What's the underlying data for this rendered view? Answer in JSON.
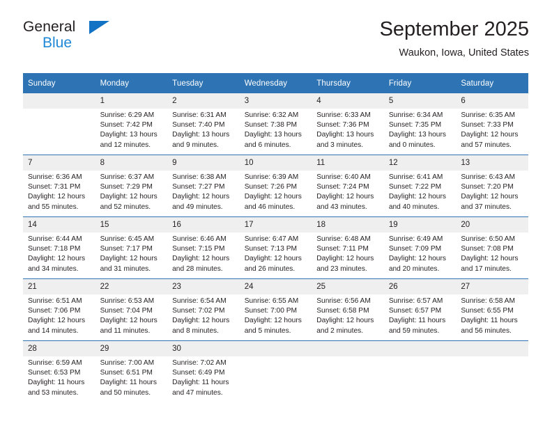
{
  "brand": {
    "name_top": "General",
    "name_bottom": "Blue",
    "triangle_color": "#1273c4",
    "accent_color": "#2e74b5"
  },
  "header": {
    "title": "September 2025",
    "subtitle": "Waukon, Iowa, United States"
  },
  "weekday_headers": [
    "Sunday",
    "Monday",
    "Tuesday",
    "Wednesday",
    "Thursday",
    "Friday",
    "Saturday"
  ],
  "weeks": [
    [
      {
        "day": "",
        "sunrise": "",
        "sunset": "",
        "daylight_line1": "",
        "daylight_line2": ""
      },
      {
        "day": "1",
        "sunrise": "Sunrise: 6:29 AM",
        "sunset": "Sunset: 7:42 PM",
        "daylight_line1": "Daylight: 13 hours",
        "daylight_line2": "and 12 minutes."
      },
      {
        "day": "2",
        "sunrise": "Sunrise: 6:31 AM",
        "sunset": "Sunset: 7:40 PM",
        "daylight_line1": "Daylight: 13 hours",
        "daylight_line2": "and 9 minutes."
      },
      {
        "day": "3",
        "sunrise": "Sunrise: 6:32 AM",
        "sunset": "Sunset: 7:38 PM",
        "daylight_line1": "Daylight: 13 hours",
        "daylight_line2": "and 6 minutes."
      },
      {
        "day": "4",
        "sunrise": "Sunrise: 6:33 AM",
        "sunset": "Sunset: 7:36 PM",
        "daylight_line1": "Daylight: 13 hours",
        "daylight_line2": "and 3 minutes."
      },
      {
        "day": "5",
        "sunrise": "Sunrise: 6:34 AM",
        "sunset": "Sunset: 7:35 PM",
        "daylight_line1": "Daylight: 13 hours",
        "daylight_line2": "and 0 minutes."
      },
      {
        "day": "6",
        "sunrise": "Sunrise: 6:35 AM",
        "sunset": "Sunset: 7:33 PM",
        "daylight_line1": "Daylight: 12 hours",
        "daylight_line2": "and 57 minutes."
      }
    ],
    [
      {
        "day": "7",
        "sunrise": "Sunrise: 6:36 AM",
        "sunset": "Sunset: 7:31 PM",
        "daylight_line1": "Daylight: 12 hours",
        "daylight_line2": "and 55 minutes."
      },
      {
        "day": "8",
        "sunrise": "Sunrise: 6:37 AM",
        "sunset": "Sunset: 7:29 PM",
        "daylight_line1": "Daylight: 12 hours",
        "daylight_line2": "and 52 minutes."
      },
      {
        "day": "9",
        "sunrise": "Sunrise: 6:38 AM",
        "sunset": "Sunset: 7:27 PM",
        "daylight_line1": "Daylight: 12 hours",
        "daylight_line2": "and 49 minutes."
      },
      {
        "day": "10",
        "sunrise": "Sunrise: 6:39 AM",
        "sunset": "Sunset: 7:26 PM",
        "daylight_line1": "Daylight: 12 hours",
        "daylight_line2": "and 46 minutes."
      },
      {
        "day": "11",
        "sunrise": "Sunrise: 6:40 AM",
        "sunset": "Sunset: 7:24 PM",
        "daylight_line1": "Daylight: 12 hours",
        "daylight_line2": "and 43 minutes."
      },
      {
        "day": "12",
        "sunrise": "Sunrise: 6:41 AM",
        "sunset": "Sunset: 7:22 PM",
        "daylight_line1": "Daylight: 12 hours",
        "daylight_line2": "and 40 minutes."
      },
      {
        "day": "13",
        "sunrise": "Sunrise: 6:43 AM",
        "sunset": "Sunset: 7:20 PM",
        "daylight_line1": "Daylight: 12 hours",
        "daylight_line2": "and 37 minutes."
      }
    ],
    [
      {
        "day": "14",
        "sunrise": "Sunrise: 6:44 AM",
        "sunset": "Sunset: 7:18 PM",
        "daylight_line1": "Daylight: 12 hours",
        "daylight_line2": "and 34 minutes."
      },
      {
        "day": "15",
        "sunrise": "Sunrise: 6:45 AM",
        "sunset": "Sunset: 7:17 PM",
        "daylight_line1": "Daylight: 12 hours",
        "daylight_line2": "and 31 minutes."
      },
      {
        "day": "16",
        "sunrise": "Sunrise: 6:46 AM",
        "sunset": "Sunset: 7:15 PM",
        "daylight_line1": "Daylight: 12 hours",
        "daylight_line2": "and 28 minutes."
      },
      {
        "day": "17",
        "sunrise": "Sunrise: 6:47 AM",
        "sunset": "Sunset: 7:13 PM",
        "daylight_line1": "Daylight: 12 hours",
        "daylight_line2": "and 26 minutes."
      },
      {
        "day": "18",
        "sunrise": "Sunrise: 6:48 AM",
        "sunset": "Sunset: 7:11 PM",
        "daylight_line1": "Daylight: 12 hours",
        "daylight_line2": "and 23 minutes."
      },
      {
        "day": "19",
        "sunrise": "Sunrise: 6:49 AM",
        "sunset": "Sunset: 7:09 PM",
        "daylight_line1": "Daylight: 12 hours",
        "daylight_line2": "and 20 minutes."
      },
      {
        "day": "20",
        "sunrise": "Sunrise: 6:50 AM",
        "sunset": "Sunset: 7:08 PM",
        "daylight_line1": "Daylight: 12 hours",
        "daylight_line2": "and 17 minutes."
      }
    ],
    [
      {
        "day": "21",
        "sunrise": "Sunrise: 6:51 AM",
        "sunset": "Sunset: 7:06 PM",
        "daylight_line1": "Daylight: 12 hours",
        "daylight_line2": "and 14 minutes."
      },
      {
        "day": "22",
        "sunrise": "Sunrise: 6:53 AM",
        "sunset": "Sunset: 7:04 PM",
        "daylight_line1": "Daylight: 12 hours",
        "daylight_line2": "and 11 minutes."
      },
      {
        "day": "23",
        "sunrise": "Sunrise: 6:54 AM",
        "sunset": "Sunset: 7:02 PM",
        "daylight_line1": "Daylight: 12 hours",
        "daylight_line2": "and 8 minutes."
      },
      {
        "day": "24",
        "sunrise": "Sunrise: 6:55 AM",
        "sunset": "Sunset: 7:00 PM",
        "daylight_line1": "Daylight: 12 hours",
        "daylight_line2": "and 5 minutes."
      },
      {
        "day": "25",
        "sunrise": "Sunrise: 6:56 AM",
        "sunset": "Sunset: 6:58 PM",
        "daylight_line1": "Daylight: 12 hours",
        "daylight_line2": "and 2 minutes."
      },
      {
        "day": "26",
        "sunrise": "Sunrise: 6:57 AM",
        "sunset": "Sunset: 6:57 PM",
        "daylight_line1": "Daylight: 11 hours",
        "daylight_line2": "and 59 minutes."
      },
      {
        "day": "27",
        "sunrise": "Sunrise: 6:58 AM",
        "sunset": "Sunset: 6:55 PM",
        "daylight_line1": "Daylight: 11 hours",
        "daylight_line2": "and 56 minutes."
      }
    ],
    [
      {
        "day": "28",
        "sunrise": "Sunrise: 6:59 AM",
        "sunset": "Sunset: 6:53 PM",
        "daylight_line1": "Daylight: 11 hours",
        "daylight_line2": "and 53 minutes."
      },
      {
        "day": "29",
        "sunrise": "Sunrise: 7:00 AM",
        "sunset": "Sunset: 6:51 PM",
        "daylight_line1": "Daylight: 11 hours",
        "daylight_line2": "and 50 minutes."
      },
      {
        "day": "30",
        "sunrise": "Sunrise: 7:02 AM",
        "sunset": "Sunset: 6:49 PM",
        "daylight_line1": "Daylight: 11 hours",
        "daylight_line2": "and 47 minutes."
      },
      {
        "day": "",
        "sunrise": "",
        "sunset": "",
        "daylight_line1": "",
        "daylight_line2": ""
      },
      {
        "day": "",
        "sunrise": "",
        "sunset": "",
        "daylight_line1": "",
        "daylight_line2": ""
      },
      {
        "day": "",
        "sunrise": "",
        "sunset": "",
        "daylight_line1": "",
        "daylight_line2": ""
      },
      {
        "day": "",
        "sunrise": "",
        "sunset": "",
        "daylight_line1": "",
        "daylight_line2": ""
      }
    ]
  ]
}
